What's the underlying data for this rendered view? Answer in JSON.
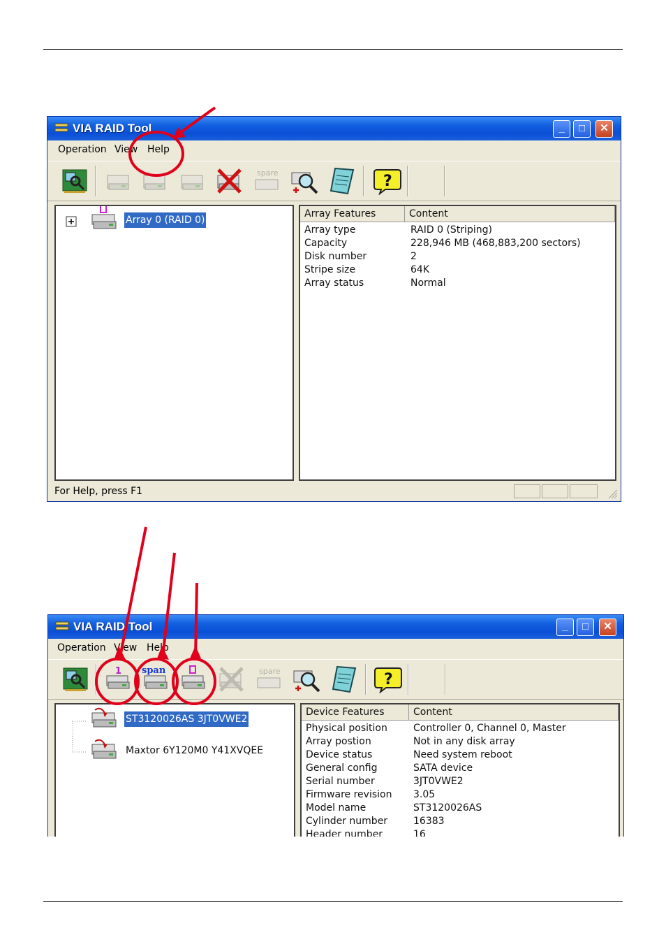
{
  "windows": [
    {
      "title": "VIA RAID Tool",
      "menu": [
        "Operation",
        "View",
        "Help"
      ],
      "tree": [
        {
          "label": "Array 0 (RAID 0)",
          "selected": true
        }
      ],
      "list_headers": [
        "Array Features",
        "Content"
      ],
      "rows": [
        [
          "Array type",
          "RAID 0 (Striping)"
        ],
        [
          "Capacity",
          "228,946 MB (468,883,200 sectors)"
        ],
        [
          "Disk number",
          "2"
        ],
        [
          "Stripe size",
          "64K"
        ],
        [
          "Array status",
          "Normal"
        ]
      ],
      "status_text": "For Help, press F1"
    },
    {
      "title": "VIA RAID Tool",
      "menu": [
        "Operation",
        "View",
        "Help"
      ],
      "tree": [
        {
          "label": "ST3120026AS 3JT0VWE2",
          "selected": true
        },
        {
          "label": "Maxtor 6Y120M0 Y41XVQEE",
          "selected": false
        }
      ],
      "list_headers": [
        "Device Features",
        "Content"
      ],
      "rows": [
        [
          "Physical position",
          "Controller 0, Channel 0, Master"
        ],
        [
          "Array postion",
          "Not in any disk array"
        ],
        [
          "Device status",
          "Need system reboot"
        ],
        [
          "General config",
          "SATA device"
        ],
        [
          "Serial number",
          "3JT0VWE2"
        ],
        [
          "Firmware revision",
          "3.05"
        ],
        [
          "Model name",
          "ST3120026AS"
        ],
        [
          "Cylinder number",
          "16383"
        ],
        [
          "Header number",
          "16"
        ]
      ]
    }
  ],
  "toolbar_icons": [
    "raid-controller-icon",
    "raid1-create-icon",
    "span-create-icon",
    "raid0-create-icon",
    "delete-array-icon",
    "spare-icon",
    "search-zoom-icon",
    "notepad-icon",
    "help-icon"
  ],
  "toolbar_icon_text": {
    "raid1": "1",
    "span": "span",
    "spare": "spare"
  },
  "colors": {
    "titlebar": "#0a4fd6",
    "selection": "#316ac5",
    "annotation": "#e0001b",
    "window_face": "#ece9d8"
  }
}
